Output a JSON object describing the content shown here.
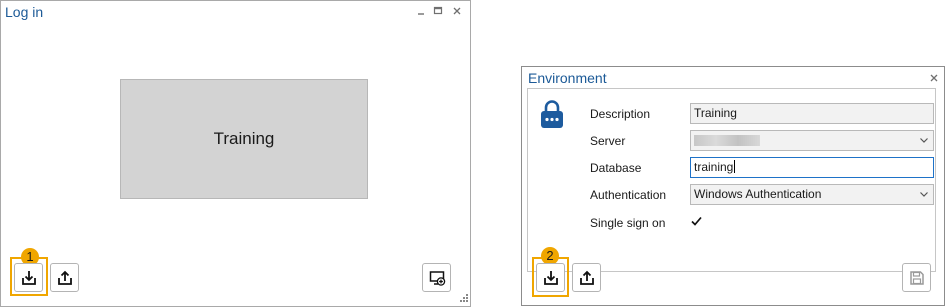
{
  "login_window": {
    "title": "Log in",
    "environment_tile": {
      "label": "Training"
    },
    "annotation_number": "1"
  },
  "environment_dialog": {
    "title": "Environment",
    "annotation_number": "2",
    "fields": {
      "description": {
        "label": "Description",
        "value": "Training"
      },
      "server": {
        "label": "Server",
        "value": ""
      },
      "database": {
        "label": "Database",
        "value": "training"
      },
      "authentication": {
        "label": "Authentication",
        "value": "Windows Authentication"
      },
      "single_sign_on": {
        "label": "Single sign on",
        "checked": true
      }
    }
  },
  "colors": {
    "title_blue": "#1c5a97",
    "highlight_orange": "#f0a600",
    "tile_gray": "#d3d3d3",
    "lock_blue": "#1d5b9e"
  },
  "icons": [
    "minimize-icon",
    "maximize-icon",
    "close-icon",
    "import-icon",
    "export-icon",
    "add-environment-icon",
    "lock-icon",
    "save-icon",
    "resize-grip-icon"
  ]
}
